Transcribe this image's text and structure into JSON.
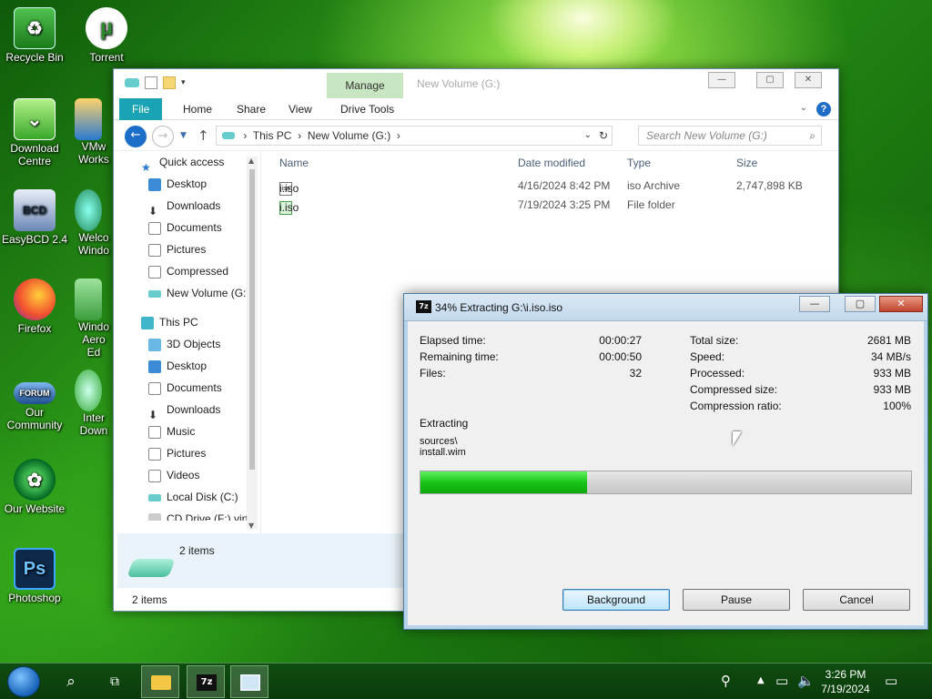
{
  "desktop": {
    "icons": [
      {
        "label": "Recycle Bin",
        "icon": "recycle-bin-icon"
      },
      {
        "label": "Torrent",
        "icon": "utorrent-icon"
      },
      {
        "label": "Download Centre",
        "icon": "download-centre-icon"
      },
      {
        "label": "VMw Works",
        "icon": "vmware-icon"
      },
      {
        "label": "EasyBCD 2.4",
        "icon": "easybcd-icon"
      },
      {
        "label": "Welco Windo",
        "icon": "windows-welcome-icon"
      },
      {
        "label": "Firefox",
        "icon": "firefox-icon"
      },
      {
        "label": "Windo Aero Ed",
        "icon": "aero-icon"
      },
      {
        "label": "Our Community",
        "icon": "forum-icon"
      },
      {
        "label": "Inter Down",
        "icon": "idm-icon"
      },
      {
        "label": "Our Website",
        "icon": "website-icon"
      },
      {
        "label": "Photoshop",
        "icon": "photoshop-icon"
      }
    ]
  },
  "explorer": {
    "title": "New Volume (G:)",
    "manage_tab": "Manage",
    "ribbon_tabs": [
      "File",
      "Home",
      "Share",
      "View",
      "Drive Tools"
    ],
    "breadcrumb": [
      "This PC",
      "New Volume (G:)"
    ],
    "search_placeholder": "Search New Volume (G:)",
    "nav": {
      "quick_access": "Quick access",
      "quick_items": [
        "Desktop",
        "Downloads",
        "Documents",
        "Pictures",
        "Compressed",
        "New Volume (G:"
      ],
      "this_pc": "This PC",
      "pc_items": [
        "3D Objects",
        "Desktop",
        "Documents",
        "Downloads",
        "Music",
        "Pictures",
        "Videos",
        "Local Disk (C:)",
        "CD Drive (F:) virt"
      ]
    },
    "columns": [
      "Name",
      "Date modified",
      "Type",
      "Size"
    ],
    "files": [
      {
        "name": "i.iso",
        "date": "4/16/2024 8:42 PM",
        "type": "iso Archive",
        "size": "2,747,898 KB"
      },
      {
        "name": "i.iso",
        "date": "7/19/2024 3:25 PM",
        "type": "File folder",
        "size": ""
      }
    ],
    "details_count": "2 items",
    "status": "2 items"
  },
  "dialog": {
    "logo": "7z",
    "title": "34% Extracting G:\\i.iso.iso",
    "progress_percent": 34,
    "left_stats": [
      {
        "label": "Elapsed time:",
        "value": "00:00:27"
      },
      {
        "label": "Remaining time:",
        "value": "00:00:50"
      },
      {
        "label": "Files:",
        "value": "32"
      }
    ],
    "right_stats": [
      {
        "label": "Total size:",
        "value": "2681 MB"
      },
      {
        "label": "Speed:",
        "value": "34 MB/s"
      },
      {
        "label": "Processed:",
        "value": "933 MB"
      },
      {
        "label": "Compressed size:",
        "value": "933 MB"
      },
      {
        "label": "Compression ratio:",
        "value": "100%"
      }
    ],
    "extracting_label": "Extracting",
    "current_path": "sources\\",
    "current_file": "install.wim",
    "buttons": {
      "background": "Background",
      "pause": "Pause",
      "cancel": "Cancel"
    }
  },
  "taskbar": {
    "time": "3:26 PM",
    "date": "7/19/2024",
    "apps": [
      "file-explorer-icon",
      "7zip-icon",
      "window-icon"
    ]
  },
  "colors": {
    "accent": "#19a3b5",
    "progress": "#17c417",
    "manage": "#c9e6c2"
  }
}
